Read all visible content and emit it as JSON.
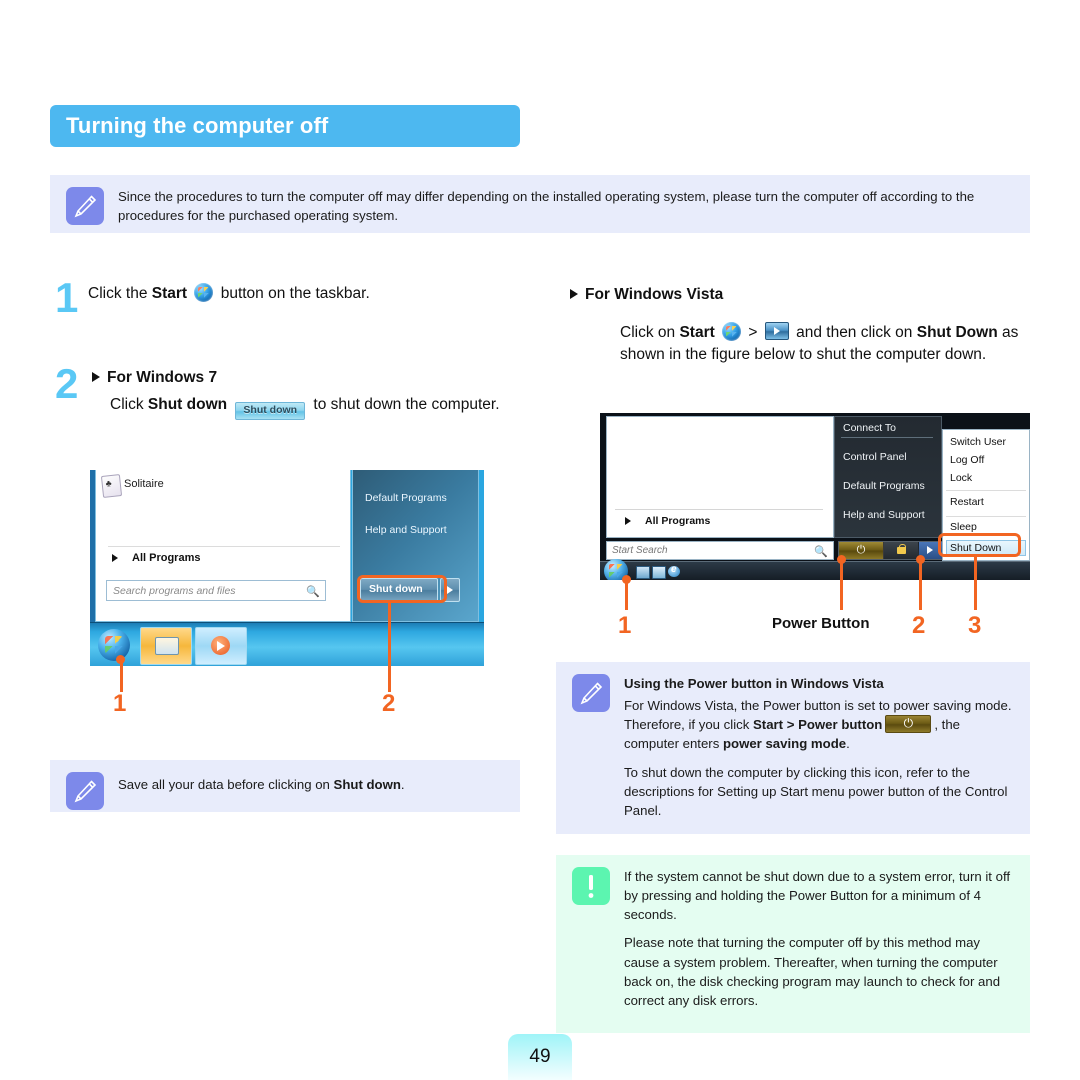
{
  "header": {
    "title": "Turning the computer off"
  },
  "top_note": {
    "icon": "pencil-note-icon",
    "text": "Since the procedures to turn the computer off may differ depending on the installed operating system, please turn the computer off according to the procedures for the purchased operating system."
  },
  "left_column": {
    "step1": {
      "number": "1",
      "text_before": "Click the",
      "bold": "Start",
      "icon": "windows-start-orb-icon",
      "text_after": "button on the taskbar."
    },
    "step2": {
      "number": "2",
      "heading": "For Windows 7",
      "text_before": "Click",
      "bold": "Shut down",
      "chip_label": "Shut down",
      "text_after": "to shut down the computer."
    },
    "figure_win7": {
      "caption_items": [
        "Solitaire",
        "All Programs"
      ],
      "search_placeholder": "Search programs and files",
      "right_items": [
        "Default Programs",
        "Help and Support"
      ],
      "shutdown_label": "Shut down",
      "callouts": [
        {
          "number": "1",
          "target": "start-orb"
        },
        {
          "number": "2",
          "target": "shut-down-button"
        }
      ]
    },
    "bottom_note": {
      "icon": "pencil-note-icon",
      "text_before": "Save all your data before clicking on",
      "bold": "Shut down",
      "text_after": "."
    }
  },
  "right_column": {
    "heading": "For Windows Vista",
    "body": {
      "t1": "Click on",
      "b1": "Start",
      "sep": ">",
      "t2": "and then click on",
      "b2": "Shut Down",
      "t3": "as shown in the figure below to shut the computer down."
    },
    "figure_vista": {
      "left_items": [
        "All Programs"
      ],
      "search_placeholder": "Start Search",
      "right_items": [
        "Connect To",
        "Control Panel",
        "Default Programs",
        "Help and Support"
      ],
      "submenu_items": [
        "Switch User",
        "Log Off",
        "Lock",
        "Restart",
        "Sleep",
        "Shut Down"
      ],
      "selected_submenu_item": "Shut Down",
      "callouts": [
        {
          "number": "1",
          "target": "start-orb"
        },
        {
          "number": "2",
          "target": "arrow-button"
        },
        {
          "number": "3",
          "target": "shut-down-menu-item"
        }
      ],
      "power_button_label": "Power Button"
    },
    "note": {
      "icon": "pencil-note-icon",
      "heading": "Using the Power button in Windows Vista",
      "p1_a": "For Windows Vista, the Power button is set to power saving mode. Therefore, if you click",
      "p1_b": "Start > Power button",
      "p1_c": ", the computer enters",
      "p1_d": "power saving mode",
      "p1_e": ".",
      "p2": "To shut down the computer by clicking this icon, refer to the descriptions for Setting up Start menu power button of the Control Panel."
    },
    "caution": {
      "icon": "exclamation-icon",
      "p1": "If the system cannot be shut down due to a system error, turn it off by pressing and holding the Power Button for a minimum of 4 seconds.",
      "p2": "Please note that turning the computer off by this method may cause a system problem. Thereafter, when turning the computer back on, the disk checking program may launch to check for and correct any disk errors."
    }
  },
  "footer": {
    "page_number": "49"
  },
  "colors": {
    "header_blue": "#4db8f0",
    "note_bg": "#e8ecfb",
    "note_icon": "#7d89ea",
    "caution_bg": "#e4fdf1",
    "caution_icon": "#5cf5b0",
    "step_number": "#5ac8f5",
    "callout_orange": "#f26522",
    "page_number_bg": "#9ff4f8"
  }
}
